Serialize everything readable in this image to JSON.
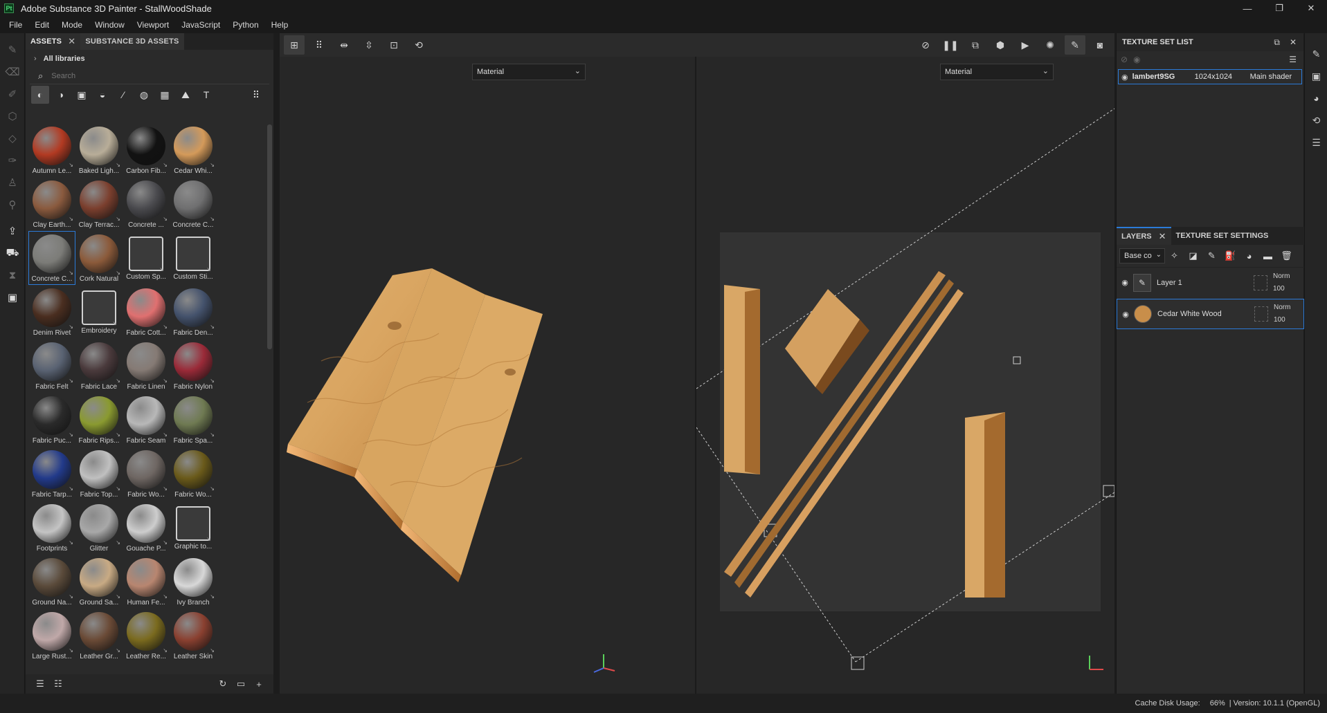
{
  "window": {
    "logo": "Pt",
    "title": "Adobe Substance 3D Painter - StallWoodShade",
    "controls": [
      "—",
      "❐",
      "✕"
    ]
  },
  "menu": [
    "File",
    "Edit",
    "Mode",
    "Window",
    "Viewport",
    "JavaScript",
    "Python",
    "Help"
  ],
  "assets": {
    "tabs": [
      {
        "label": "ASSETS"
      },
      {
        "label": "SUBSTANCE 3D ASSETS"
      }
    ],
    "library": "All libraries",
    "search_placeholder": "Search",
    "items": [
      {
        "label": "Autumn Le...",
        "color": "#b23a22"
      },
      {
        "label": "Baked Ligh...",
        "color": "#b8ad98"
      },
      {
        "label": "Carbon Fib...",
        "color": "#121212"
      },
      {
        "label": "Cedar Whi...",
        "color": "#d49a5a"
      },
      {
        "label": "Clay Earth...",
        "color": "#8a5a3e"
      },
      {
        "label": "Clay Terrac...",
        "color": "#7b3f2e"
      },
      {
        "label": "Concrete ...",
        "color": "#4a4a4e"
      },
      {
        "label": "Concrete C...",
        "color": "#6f6f70"
      },
      {
        "label": "Concrete C...",
        "color": "#7c7c78"
      },
      {
        "label": "Cork Natural",
        "color": "#8b5a3a"
      },
      {
        "label": "Custom Sp...",
        "color": "#3a3a3a"
      },
      {
        "label": "Custom Sti...",
        "color": "#3a3a3a"
      },
      {
        "label": "Denim Rivet",
        "color": "#4a2e20"
      },
      {
        "label": "Embroidery",
        "color": "#3a3a3a"
      },
      {
        "label": "Fabric Cott...",
        "color": "#e07070"
      },
      {
        "label": "Fabric Den...",
        "color": "#44526c"
      },
      {
        "label": "Fabric Felt",
        "color": "#596272"
      },
      {
        "label": "Fabric Lace",
        "color": "#4a3a3c"
      },
      {
        "label": "Fabric Linen",
        "color": "#857a74"
      },
      {
        "label": "Fabric Nylon",
        "color": "#9a2a38"
      },
      {
        "label": "Fabric Puc...",
        "color": "#2a2a2a"
      },
      {
        "label": "Fabric Rips...",
        "color": "#8a9a30"
      },
      {
        "label": "Fabric Seam",
        "color": "#b8b8b8"
      },
      {
        "label": "Fabric Spa...",
        "color": "#6f7a52"
      },
      {
        "label": "Fabric Tarp...",
        "color": "#223a8a"
      },
      {
        "label": "Fabric Top...",
        "color": "#c0c0c0"
      },
      {
        "label": "Fabric Wo...",
        "color": "#6e6662"
      },
      {
        "label": "Fabric Wo...",
        "color": "#6a5a1a"
      },
      {
        "label": "Footprints",
        "color": "#c4c4c4"
      },
      {
        "label": "Glitter",
        "color": "#a8a8a8"
      },
      {
        "label": "Gouache P...",
        "color": "#cdcdcd"
      },
      {
        "label": "Graphic to...",
        "color": "#3a3a3a"
      },
      {
        "label": "Ground Na...",
        "color": "#5a4a3a"
      },
      {
        "label": "Ground Sa...",
        "color": "#c8aa84"
      },
      {
        "label": "Human Fe...",
        "color": "#b88670"
      },
      {
        "label": "Ivy Branch",
        "color": "#d8d8d8"
      },
      {
        "label": "Large Rust...",
        "color": "#c0a8a8"
      },
      {
        "label": "Leather Gr...",
        "color": "#6a4a36"
      },
      {
        "label": "Leather Re...",
        "color": "#7a6a1e"
      },
      {
        "label": "Leather Skin",
        "color": "#8a4030"
      }
    ]
  },
  "viewport": {
    "left_mode": "Material",
    "right_mode": "Material"
  },
  "texture_set_list": {
    "title": "TEXTURE SET LIST",
    "row": {
      "name": "lambert9SG",
      "resolution": "1024x1024",
      "shader": "Main shader"
    }
  },
  "layers": {
    "tabs": [
      {
        "label": "LAYERS"
      },
      {
        "label": "TEXTURE SET SETTINGS"
      }
    ],
    "channel": "Base co",
    "items": [
      {
        "name": "Layer 1",
        "blend": "Norm",
        "opacity": "100"
      },
      {
        "name": "Cedar White Wood",
        "blend": "Norm",
        "opacity": "100"
      }
    ]
  },
  "status": {
    "cache_label": "Cache Disk Usage:",
    "cache_value": "66%",
    "version": "| Version: 10.1.1 (OpenGL)"
  }
}
